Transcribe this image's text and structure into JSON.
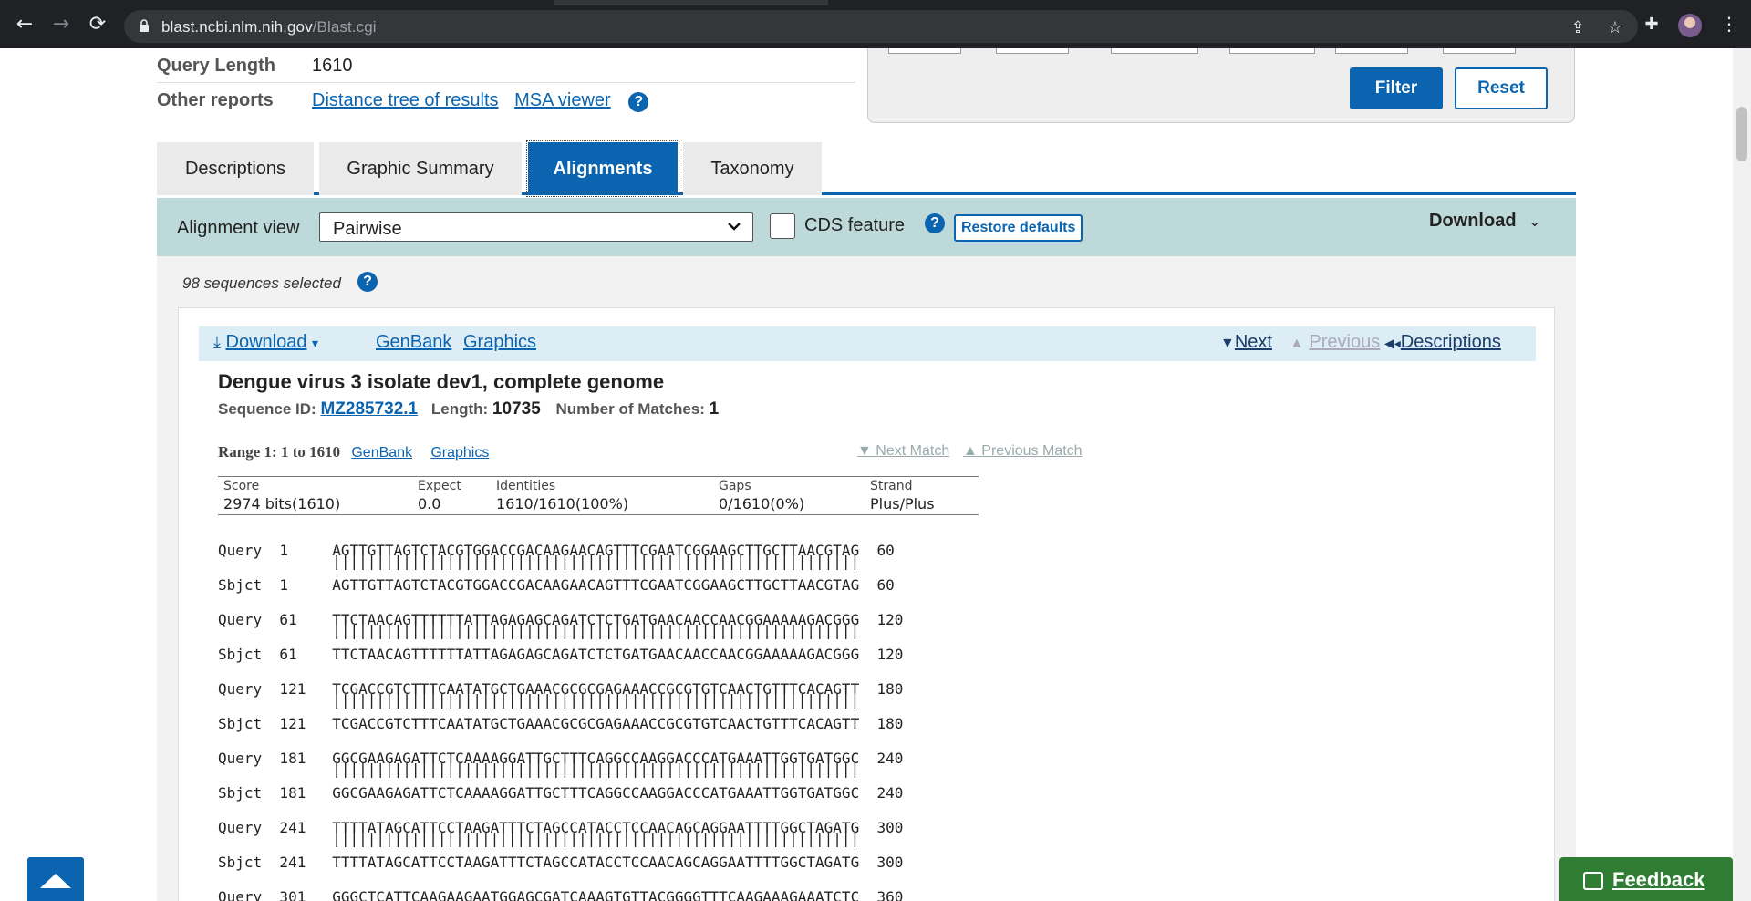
{
  "browser": {
    "url_host": "blast.ncbi.nlm.nih.gov",
    "url_path": "/Blast.cgi"
  },
  "info": {
    "query_length_label": "Query Length",
    "query_length_value": "1610",
    "other_reports_label": "Other reports",
    "distance_tree_link": "Distance tree of results",
    "msa_viewer_link": "MSA viewer",
    "help": "?"
  },
  "filter": {
    "filter_label": "Filter",
    "reset_label": "Reset"
  },
  "tabs": [
    {
      "label": "Descriptions"
    },
    {
      "label": "Graphic Summary"
    },
    {
      "label": "Alignments"
    },
    {
      "label": "Taxonomy"
    }
  ],
  "align_bar": {
    "view_label": "Alignment view",
    "view_value": "Pairwise",
    "cds_label": "CDS feature",
    "restore_label": "Restore defaults",
    "download_label": "Download"
  },
  "selected_text": "98 sequences selected",
  "result": {
    "download": "Download",
    "genbank": "GenBank",
    "graphics": "Graphics",
    "next": "Next",
    "previous": "Previous",
    "descriptions": "Descriptions",
    "title": "Dengue virus 3 isolate dev1, complete genome",
    "seq_id_label": "Sequence ID:",
    "seq_id": "MZ285732.1",
    "length_label": "Length:",
    "length": "10735",
    "matches_label": "Number of Matches:",
    "matches": "1",
    "range_label": "Range 1: 1 to 1610",
    "range_genbank": "GenBank",
    "range_graphics": "Graphics",
    "next_match": "Next Match",
    "previous_match": "Previous Match"
  },
  "stats": {
    "headers": [
      "Score",
      "Expect",
      "Identities",
      "Gaps",
      "Strand"
    ],
    "values": [
      "2974 bits(1610)",
      "0.0",
      "1610/1610(100%)",
      "0/1610(0%)",
      "Plus/Plus"
    ]
  },
  "alignment": [
    {
      "q_start": "1",
      "q_seq": "AGTTGTTAGTCTACGTGGACCGACAAGAACAGTTTCGAATCGGAAGCTTGCTTAACGTAG",
      "q_end": "60",
      "s_start": "1",
      "s_seq": "AGTTGTTAGTCTACGTGGACCGACAAGAACAGTTTCGAATCGGAAGCTTGCTTAACGTAG",
      "s_end": "60"
    },
    {
      "q_start": "61",
      "q_seq": "TTCTAACAGTTTTTTATTAGAGAGCAGATCTCTGATGAACAACCAACGGAAAAAGACGGG",
      "q_end": "120",
      "s_start": "61",
      "s_seq": "TTCTAACAGTTTTTTATTAGAGAGCAGATCTCTGATGAACAACCAACGGAAAAAGACGGG",
      "s_end": "120"
    },
    {
      "q_start": "121",
      "q_seq": "TCGACCGTCTTTCAATATGCTGAAACGCGCGAGAAACCGCGTGTCAACTGTTTCACAGTT",
      "q_end": "180",
      "s_start": "121",
      "s_seq": "TCGACCGTCTTTCAATATGCTGAAACGCGCGAGAAACCGCGTGTCAACTGTTTCACAGTT",
      "s_end": "180"
    },
    {
      "q_start": "181",
      "q_seq": "GGCGAAGAGATTCTCAAAAGGATTGCTTTCAGGCCAAGGACCCATGAAATTGGTGATGGC",
      "q_end": "240",
      "s_start": "181",
      "s_seq": "GGCGAAGAGATTCTCAAAAGGATTGCTTTCAGGCCAAGGACCCATGAAATTGGTGATGGC",
      "s_end": "240"
    },
    {
      "q_start": "241",
      "q_seq": "TTTTATAGCATTCCTAAGATTTCTAGCCATACCTCCAACAGCAGGAATTTTGGCTAGATG",
      "q_end": "300",
      "s_start": "241",
      "s_seq": "TTTTATAGCATTCCTAAGATTTCTAGCCATACCTCCAACAGCAGGAATTTTGGCTAGATG",
      "s_end": "300"
    },
    {
      "q_start": "301",
      "q_seq": "GGGCTCATTCAAGAAGAATGGAGCGATCAAAGTGTTACGGGGTTTCAAGAAAGAAATCTC",
      "q_end": "360",
      "s_start": "",
      "s_seq": "",
      "s_end": ""
    }
  ],
  "labels": {
    "query": "Query",
    "sbjct": "Sbjct"
  },
  "feedback_label": "Feedback"
}
